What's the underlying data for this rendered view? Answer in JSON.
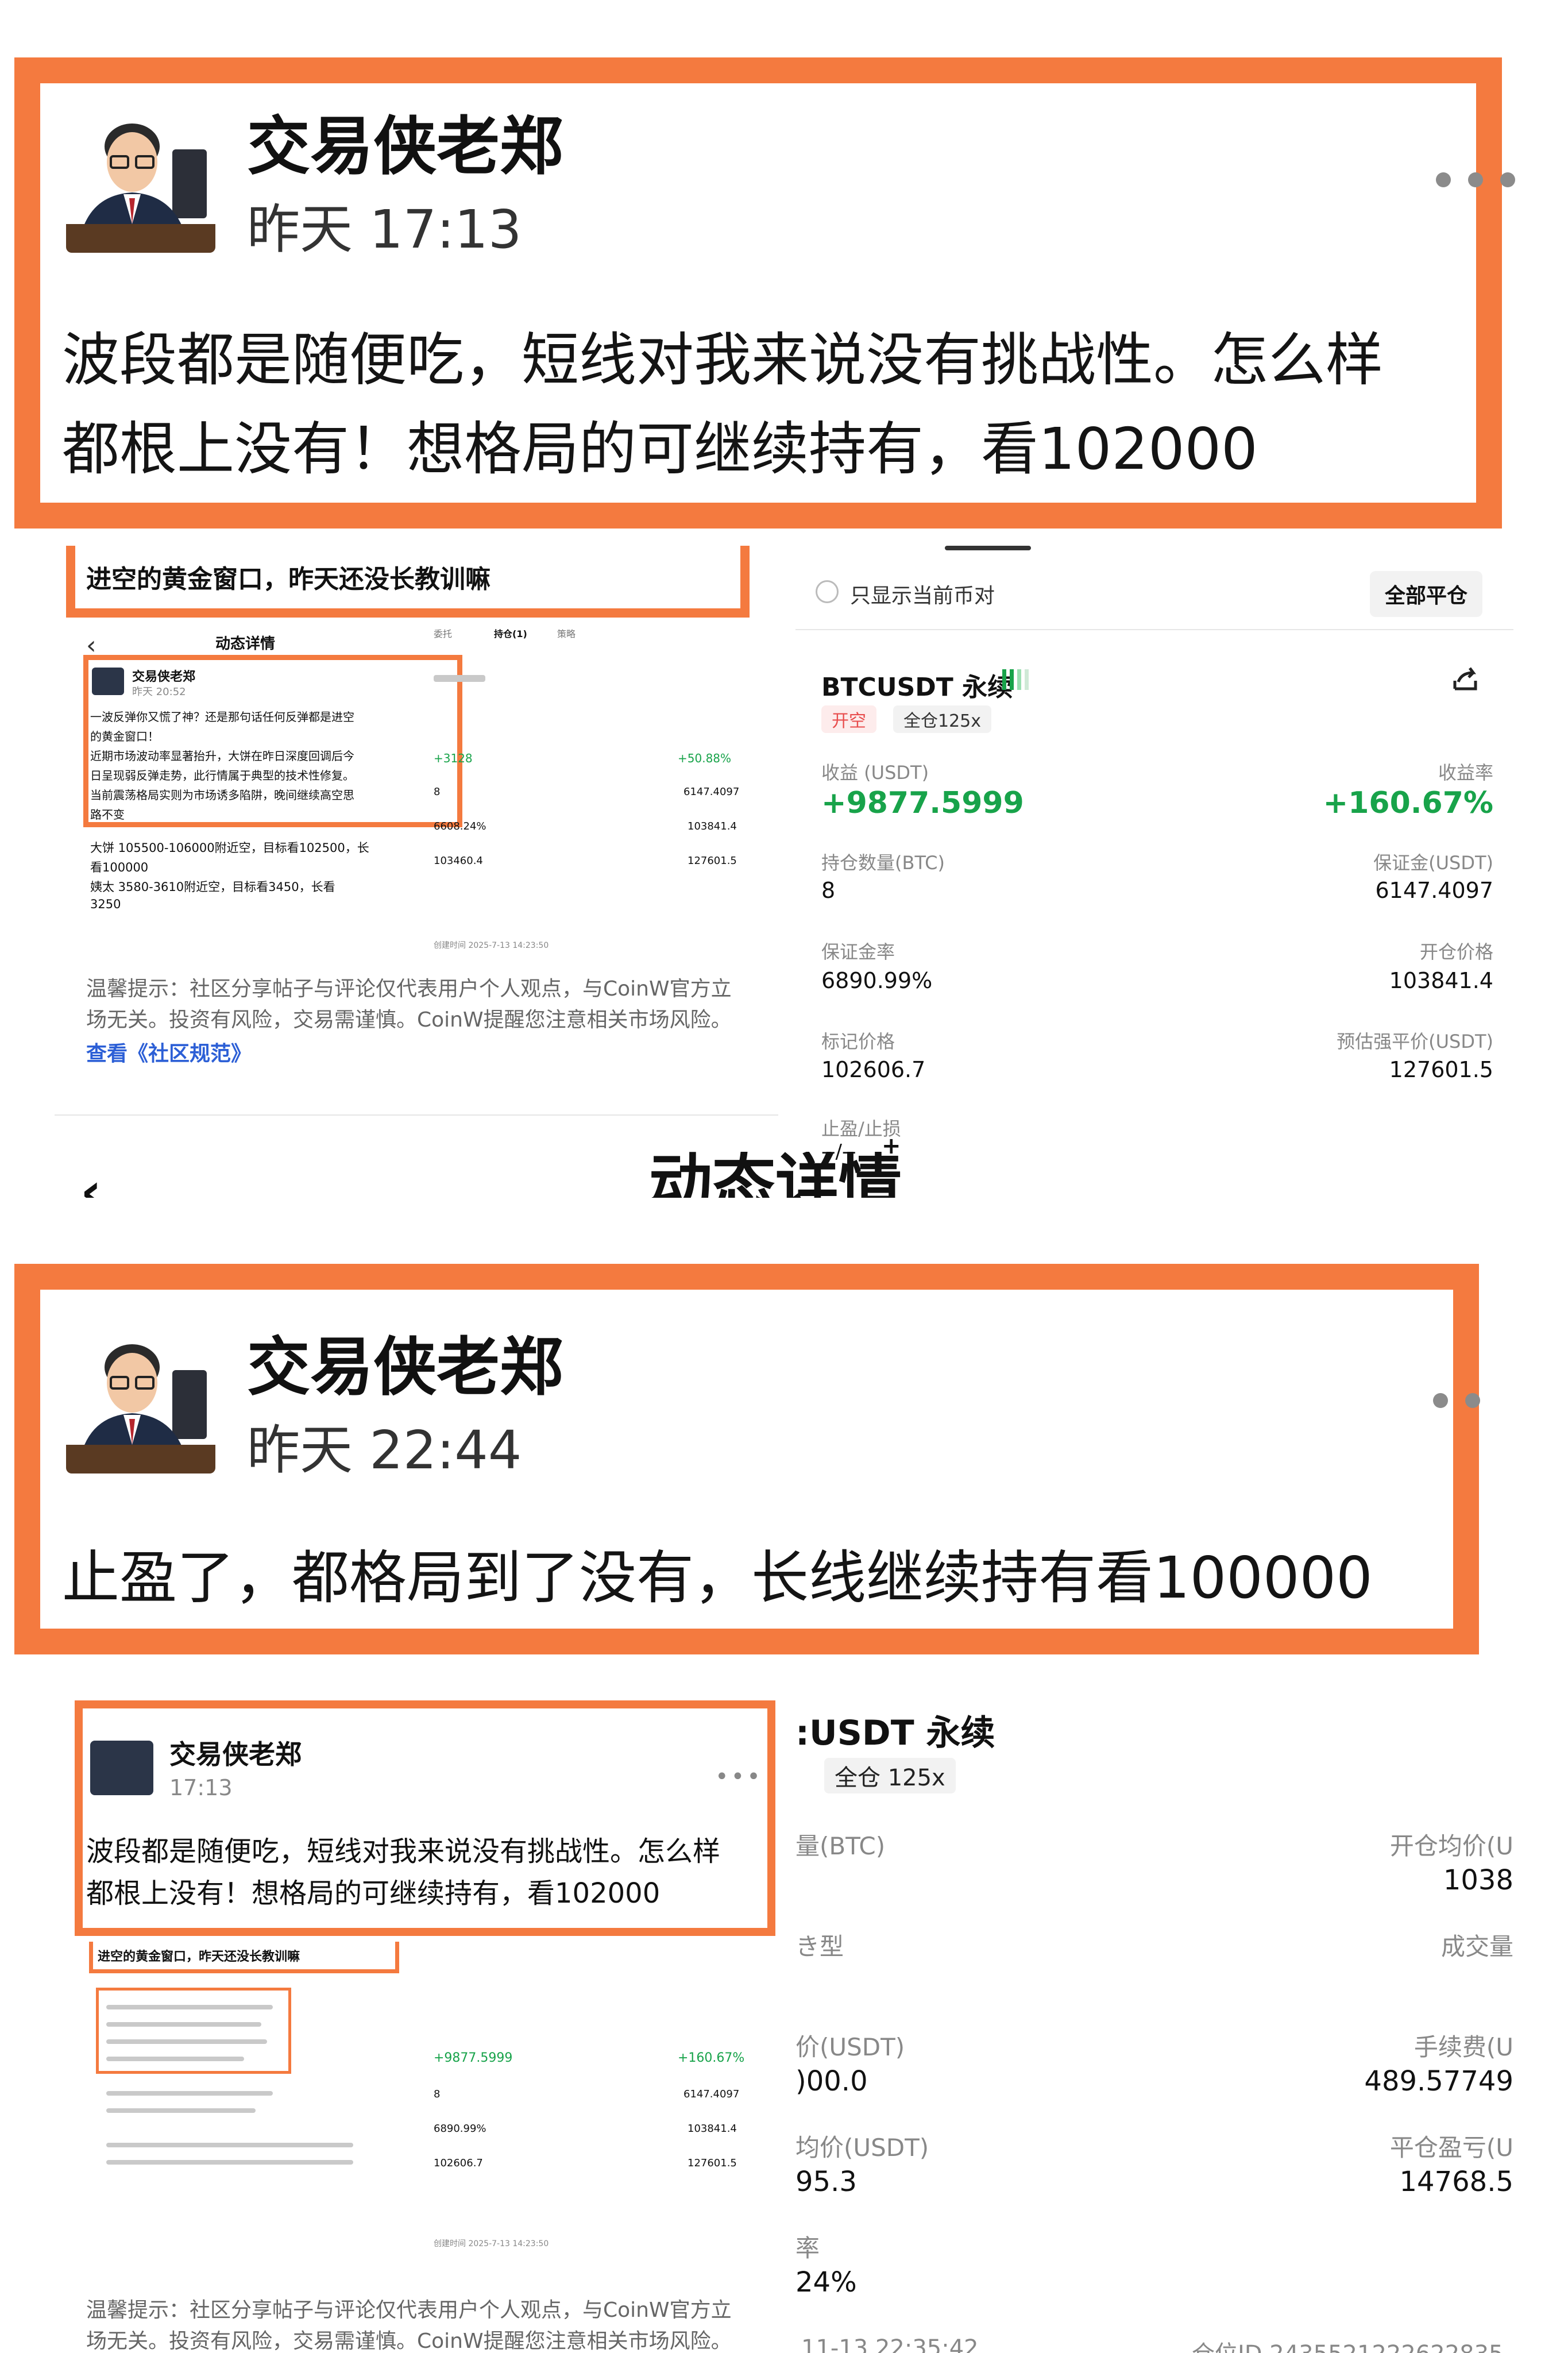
{
  "post1": {
    "author": "交易侠老郑",
    "time": "昨天 17:13",
    "line1": "波段都是随便吃，短线对我来说没有挑战性。怎么样",
    "line2": "都根上没有！想格局的可继续持有，看102000"
  },
  "shot1": {
    "banner": "进空的黄金窗口，昨天还没长教训嘛",
    "header_title": "动态详情",
    "inner_author": "交易侠老郑",
    "inner_time": "昨天 20:52",
    "inner_lines": [
      "一波反弹你又慌了神？还是那句话任何反弹都是进空",
      "的黄金窗口！",
      "近期市场波动率显著抬升，大饼在昨日深度回调后今",
      "日呈现弱反弹走势，此行情属于典型的技术性修复。",
      "当前震荡格局实则为市场诱多陷阱，晚间继续高空思",
      "路不变"
    ],
    "inner_plan": [
      "大饼 105500-106000附近空，目标看102500，长",
      "看100000",
      "姨太 3580-3610附近空，目标看3450，长看",
      "3250"
    ],
    "disclaimer1": "温馨提示：社区分享帖子与评论仅代表用户个人观点，与CoinW官方立",
    "disclaimer2": "场无关。投资有风险，交易需谨慎。CoinW提醒您注意相关市场风险。",
    "rules_link": "查看《社区规范》",
    "mini_tabs": [
      "委托",
      "持仓(1)",
      "策略"
    ],
    "mini_values": [
      "+3128",
      "+50.88%",
      "8",
      "6147.4097",
      "6608.24%",
      "103841.4",
      "103460.4",
      "127601.5"
    ],
    "mini_timestamp": "创建时间 2025-7-13 14:23:50"
  },
  "position": {
    "only_current": "只显示当前币对",
    "close_all": "全部平仓",
    "symbol": "BTCUSDT 永续",
    "side": "开空",
    "margin_mode": "全仓125x",
    "pnl_label": "收益 (USDT)",
    "pnl": "+9877.5999",
    "roe_label": "收益率",
    "roe": "+160.67%",
    "qty_label": "持仓数量(BTC)",
    "qty": "8",
    "margin_label": "保证金(USDT)",
    "margin": "6147.4097",
    "margin_ratio_label": "保证金率",
    "margin_ratio": "6890.99%",
    "entry_label": "开仓价格",
    "entry": "103841.4",
    "mark_label": "标记价格",
    "mark": "102606.7",
    "liq_label": "预估强平价(USDT)",
    "liq": "127601.5",
    "tpsl_label": "止盈/止损",
    "tpsl": "--/--",
    "plus": "+"
  },
  "cut_title": "动态详情",
  "post2": {
    "author": "交易侠老郑",
    "time": "昨天 22:44",
    "line1": "止盈了，都格局到了没有，长线继续持有看100000"
  },
  "shot2": {
    "inner_author": "交易侠老郑",
    "inner_time": "17:13",
    "inner_line1": "波段都是随便吃，短线对我来说没有挑战性。怎么样",
    "inner_line2": "都根上没有！想格局的可继续持有，看102000",
    "inner_banner": "进空的黄金窗口，昨天还没长教训嘛",
    "mini_pnl": "+9877.5999",
    "mini_roe": "+160.67%",
    "mini_vals": [
      "8",
      "6147.4097",
      "6890.99%",
      "103841.4",
      "102606.7",
      "127601.5"
    ],
    "mini_timestamp": "创建时间 2025-7-13 14:23:50",
    "disclaimer1": "温馨提示：社区分享帖子与评论仅代表用户个人观点，与CoinW官方立",
    "disclaimer2": "场无关。投资有风险，交易需谨慎。CoinW提醒您注意相关市场风险。"
  },
  "closed": {
    "symbol": ":USDT 永续",
    "mode": "全仓 125x",
    "qty_label": "量(BTC)",
    "avg_open_label": "开仓均价(U",
    "avg_open": "1038",
    "type_label": "き型",
    "volume_label": "成交量",
    "close_price_label": "价(USDT)",
    "close_price": ")00.0",
    "fee_label": "手续费(U",
    "fee": "489.57749",
    "avg_close_label": "均价(USDT)",
    "avg_close": "95.3",
    "realized_label": "平仓盈亏(U",
    "realized": "14768.5",
    "rate_label": "率",
    "rate": "24%",
    "bottom_time": "11-13 22:35:42",
    "bottom_id": "仓位ID 2435521222622835"
  }
}
